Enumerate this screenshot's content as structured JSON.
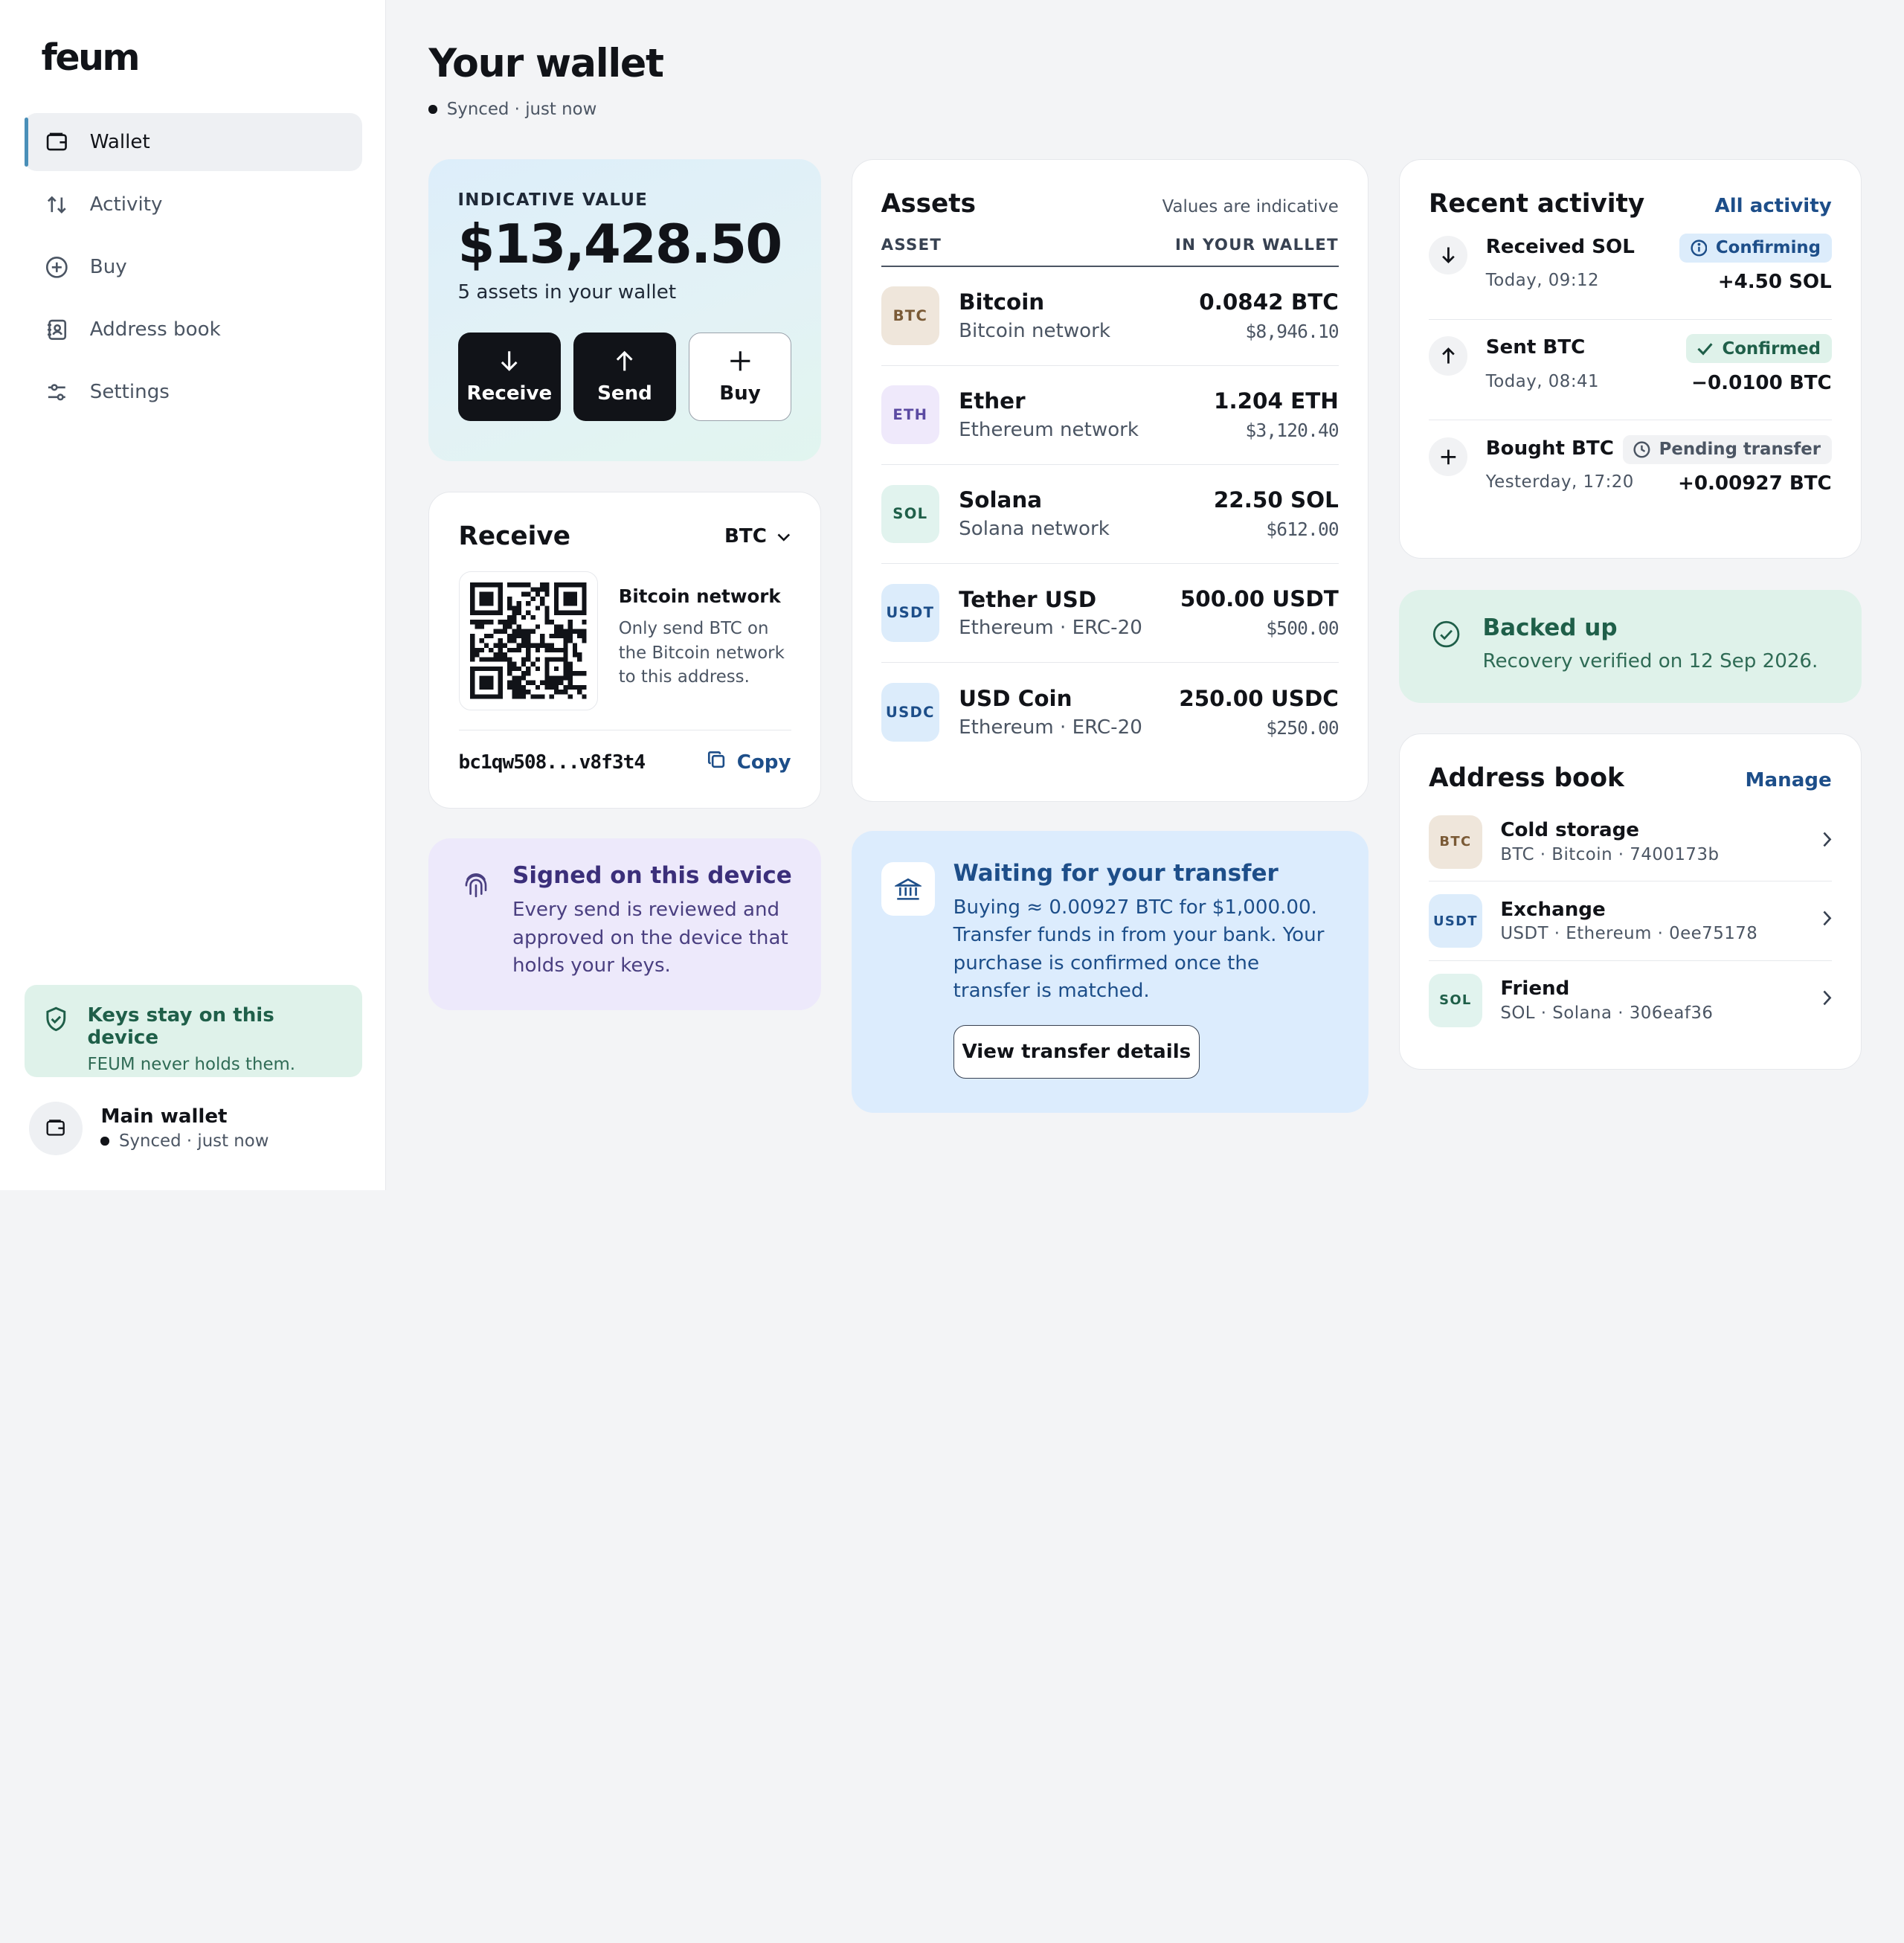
{
  "brand": {
    "logo": "feum"
  },
  "sidebar": {
    "items": [
      {
        "label": "Wallet",
        "icon": "wallet-icon",
        "active": true
      },
      {
        "label": "Activity",
        "icon": "arrows-up-down-icon"
      },
      {
        "label": "Buy",
        "icon": "plus-circle-icon"
      },
      {
        "label": "Address book",
        "icon": "address-book-icon"
      },
      {
        "label": "Settings",
        "icon": "sliders-icon"
      }
    ],
    "keys": {
      "title": "Keys stay on this device",
      "subtitle": "FEUM never holds them."
    },
    "wallet": {
      "name": "Main wallet",
      "status": "Synced · just now"
    }
  },
  "header": {
    "title": "Your wallet",
    "status": "Synced · just now"
  },
  "value": {
    "label": "INDICATIVE VALUE",
    "amount": "$13,428.50",
    "subtitle": "5 assets in your wallet",
    "actions": {
      "receive": "Receive",
      "send": "Send",
      "buy": "Buy"
    }
  },
  "receive": {
    "title": "Receive",
    "selected_asset": "BTC",
    "network_title": "Bitcoin network",
    "network_desc": "Only send BTC on the Bitcoin network to this address.",
    "address": "bc1qw508...v8f3t4",
    "copy_label": "Copy"
  },
  "signed": {
    "title": "Signed on this device",
    "desc": "Every send is reviewed and approved on the device that holds your keys."
  },
  "assets": {
    "title": "Assets",
    "note": "Values are indicative",
    "col_asset": "ASSET",
    "col_wallet": "IN YOUR WALLET",
    "rows": [
      {
        "symbol": "BTC",
        "name": "Bitcoin",
        "network": "Bitcoin network",
        "amount": "0.0842 BTC",
        "value": "$8,946.10"
      },
      {
        "symbol": "ETH",
        "name": "Ether",
        "network": "Ethereum network",
        "amount": "1.204 ETH",
        "value": "$3,120.40"
      },
      {
        "symbol": "SOL",
        "name": "Solana",
        "network": "Solana network",
        "amount": "22.50 SOL",
        "value": "$612.00"
      },
      {
        "symbol": "USDT",
        "name": "Tether USD",
        "network": "Ethereum · ERC-20",
        "amount": "500.00 USDT",
        "value": "$500.00"
      },
      {
        "symbol": "USDC",
        "name": "USD Coin",
        "network": "Ethereum · ERC-20",
        "amount": "250.00 USDC",
        "value": "$250.00"
      }
    ]
  },
  "waiting": {
    "title": "Waiting for your transfer",
    "desc": "Buying ≈ 0.00927 BTC for $1,000.00. Transfer funds in from your bank. Your purchase is confirmed once the transfer is matched.",
    "button": "View transfer details"
  },
  "activity": {
    "title": "Recent activity",
    "link": "All activity",
    "rows": [
      {
        "title": "Received SOL",
        "time": "Today, 09:12",
        "status": "Confirming",
        "amount": "+4.50 SOL",
        "icon": "arrow-down-icon"
      },
      {
        "title": "Sent BTC",
        "time": "Today, 08:41",
        "status": "Confirmed",
        "amount": "−0.0100 BTC",
        "icon": "arrow-up-icon"
      },
      {
        "title": "Bought BTC",
        "time": "Yesterday, 17:20",
        "status": "Pending transfer",
        "amount": "+0.00927 BTC",
        "icon": "plus-icon"
      }
    ]
  },
  "backup": {
    "title": "Backed up",
    "desc": "Recovery verified on 12 Sep 2026."
  },
  "address_book": {
    "title": "Address book",
    "link": "Manage",
    "rows": [
      {
        "symbol": "BTC",
        "name": "Cold storage",
        "detail": "BTC · Bitcoin · 7400173b"
      },
      {
        "symbol": "USDT",
        "name": "Exchange",
        "detail": "USDT · Ethereum · 0ee75178"
      },
      {
        "symbol": "SOL",
        "name": "Friend",
        "detail": "SOL · Solana · 306eaf36"
      }
    ]
  }
}
